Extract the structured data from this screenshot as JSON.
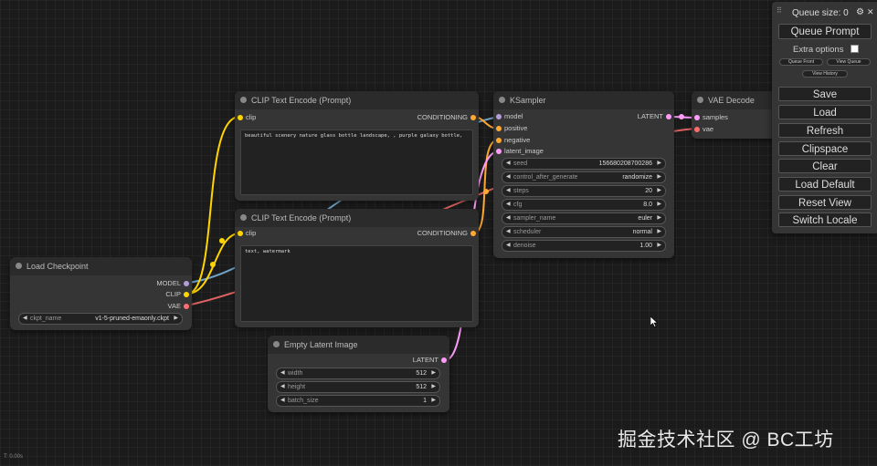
{
  "colors": {
    "model": "#b39ddb",
    "clip": "#ffd500",
    "vae": "#ff6e6e",
    "conditioning": "#ffa931",
    "latent": "#ff9cf9",
    "wire_blue": "#7ab0d8"
  },
  "nodes": {
    "clip_pos": {
      "title": "CLIP Text Encode (Prompt)",
      "input_clip": "clip",
      "output": "CONDITIONING",
      "text": "beautiful scenery nature glass bottle landscape, , purple galaxy bottle,"
    },
    "clip_neg": {
      "title": "CLIP Text Encode (Prompt)",
      "input_clip": "clip",
      "output": "CONDITIONING",
      "text": "text, watermark"
    },
    "ksampler": {
      "title": "KSampler",
      "inputs": [
        "model",
        "positive",
        "negative",
        "latent_image"
      ],
      "output": "LATENT",
      "widgets": [
        {
          "label": "seed",
          "value": "156680208700286"
        },
        {
          "label": "control_after_generate",
          "value": "randomize"
        },
        {
          "label": "steps",
          "value": "20"
        },
        {
          "label": "cfg",
          "value": "8.0"
        },
        {
          "label": "sampler_name",
          "value": "euler"
        },
        {
          "label": "scheduler",
          "value": "normal"
        },
        {
          "label": "denoise",
          "value": "1.00"
        }
      ]
    },
    "vae_decode": {
      "title": "VAE Decode",
      "inputs": [
        "samples",
        "vae"
      ]
    },
    "checkpoint": {
      "title": "Load Checkpoint",
      "outputs": [
        "MODEL",
        "CLIP",
        "VAE"
      ],
      "widget": {
        "label": "ckpt_name",
        "value": "v1-5-pruned-emaonly.ckpt"
      }
    },
    "latent": {
      "title": "Empty Latent Image",
      "output": "LATENT",
      "widgets": [
        {
          "label": "width",
          "value": "512"
        },
        {
          "label": "height",
          "value": "512"
        },
        {
          "label": "batch_size",
          "value": "1"
        }
      ]
    }
  },
  "menu": {
    "queue_size": "Queue size: 0",
    "queue_prompt": "Queue Prompt",
    "extra_options": "Extra options",
    "queue_front": "Queue Front",
    "view_queue": "View Queue",
    "view_history": "View History",
    "save": "Save",
    "load": "Load",
    "refresh": "Refresh",
    "clipspace": "Clipspace",
    "clear": "Clear",
    "load_default": "Load Default",
    "reset_view": "Reset View",
    "switch_locale": "Switch Locale"
  },
  "watermark": "掘金技术社区 @ BC工坊",
  "fps": "T: 0.00s"
}
